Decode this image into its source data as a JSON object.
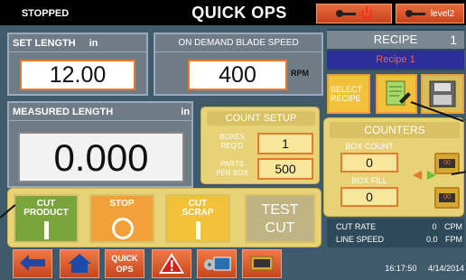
{
  "header": {
    "status": "STOPPED",
    "title": "QUICK OPS",
    "level_button_label": "level2"
  },
  "set_length": {
    "title": "SET LENGTH",
    "unit": "in",
    "value": "12.00"
  },
  "blade_speed": {
    "title": "ON DEMAND BLADE SPEED",
    "value": "400",
    "unit": "RPM"
  },
  "measured_length": {
    "title": "MEASURED LENGTH",
    "unit": "in",
    "value": "0.000"
  },
  "count_setup": {
    "title": "COUNT SETUP",
    "boxes_label_1": "BOXES",
    "boxes_label_2": "REQ'D",
    "boxes_value": "1",
    "parts_label_1": "PARTS",
    "parts_label_2": "PER BOX",
    "parts_value": "500"
  },
  "actions": {
    "cut_product_1": "CUT",
    "cut_product_2": "PRODUCT",
    "stop": "STOP",
    "cut_scrap_1": "CUT",
    "cut_scrap_2": "SCRAP",
    "test_1": "TEST",
    "test_2": "CUT"
  },
  "nav": {
    "quick_ops_1": "QUICK",
    "quick_ops_2": "OPS"
  },
  "recipe": {
    "title": "RECIPE",
    "number": "1",
    "name": "Recipe 1",
    "select_1": "SELECT",
    "select_2": "RECIPE"
  },
  "counters": {
    "title": "COUNTERS",
    "box_count_label": "BOX COUNT",
    "box_count_value": "0",
    "box_fill_label": "BOX FILL",
    "box_fill_value": "0",
    "counter_digits": "00"
  },
  "rates": {
    "cut_rate_label": "CUT RATE",
    "cut_rate_value": "0",
    "cut_rate_unit": "CPM",
    "line_speed_label": "LINE SPEED",
    "line_speed_value": "0.0",
    "line_speed_unit": "FPM"
  },
  "clock": {
    "time": "16:17:50",
    "date": "4/14/2014"
  },
  "colors": {
    "accent_orange": "#e8782c",
    "panel_gold": "#e7d277",
    "panel_gray": "#6f7c85",
    "recipe_blue": "#2c2f9a"
  }
}
